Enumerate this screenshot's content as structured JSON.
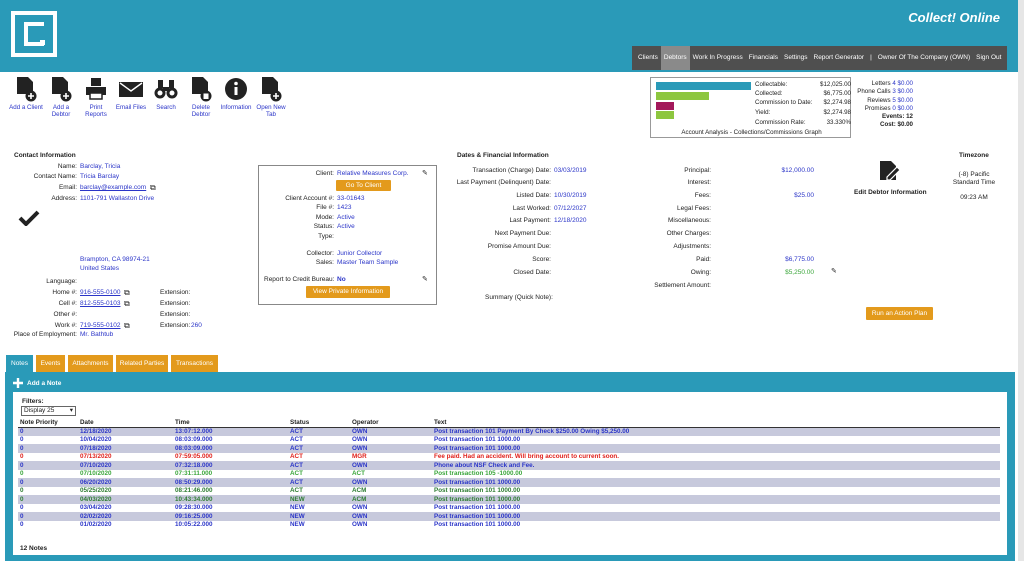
{
  "app": {
    "brand": "Collect! Online"
  },
  "topnav": [
    "Clients",
    "Debtors",
    "Work In Progress",
    "Financials",
    "Settings",
    "Report Generator",
    "|",
    "Owner Of The Company (OWN)",
    "Sign Out"
  ],
  "toolbar": [
    {
      "label": "Add a Client",
      "icon": "add-document-icon"
    },
    {
      "label": "Add a Debtor",
      "icon": "add-document-icon"
    },
    {
      "label": "Print Reports",
      "icon": "printer-icon"
    },
    {
      "label": "Email Files",
      "icon": "envelope-icon"
    },
    {
      "label": "Search",
      "icon": "binoculars-icon"
    },
    {
      "label": "Delete Debtor",
      "icon": "delete-document-icon"
    },
    {
      "label": "Information",
      "icon": "info-icon"
    },
    {
      "label": "Open New Tab",
      "icon": "add-document-icon"
    }
  ],
  "analysis": {
    "rows": [
      {
        "label": "Collectable:",
        "value": "$12,025.00"
      },
      {
        "label": "Collected:",
        "value": "$6,775.00"
      },
      {
        "label": "Commission to Date:",
        "value": "$2,274.98"
      },
      {
        "label": "Yield:",
        "value": "$2,274.98"
      },
      {
        "label": "Commission Rate:",
        "value": "33.330%"
      }
    ],
    "bars": [
      {
        "fraction": 1.0,
        "color": "#2a9ab8"
      },
      {
        "fraction": 0.563,
        "color": "#8dc63f"
      },
      {
        "fraction": 0.19,
        "color": "#a3195b"
      },
      {
        "fraction": 0.19,
        "color": "#8dc63f"
      }
    ],
    "caption": "Account Analysis - Collections/Commissions Graph"
  },
  "stats": {
    "letters": "Letters",
    "letters_n": "4",
    "letters_v": "$0.00",
    "calls": "Phone Calls",
    "calls_n": "3",
    "calls_v": "$0.00",
    "reviews": "Reviews",
    "reviews_n": "5",
    "reviews_v": "$0.00",
    "promises": "Promises",
    "promises_n": "0",
    "promises_v": "$0.00",
    "events": "Events: 12",
    "cost": "Cost: $0.00"
  },
  "contact": {
    "title": "Contact Information",
    "name_l": "Name:",
    "name": "Barclay, Tricia",
    "cname_l": "Contact Name:",
    "cname": "Tricia Barclay",
    "email_l": "Email:",
    "email": "barclay@example.com",
    "address_l": "Address:",
    "address": "1101-791 Wallaston Drive",
    "city": "Brampton, CA 98974-21",
    "country": "United States",
    "language_l": "Language:",
    "home_l": "Home #:",
    "home": "916-555-0100",
    "cell_l": "Cell #:",
    "cell": "812-555-0103",
    "other_l": "Other #:",
    "work_l": "Work #:",
    "work": "719-555-0102",
    "ext_l": "Extension:",
    "work_ext": "260",
    "employ_l": "Place of Employment:",
    "employ": "Mr. Bathtub"
  },
  "client": {
    "client_l": "Client:",
    "client": "Relative Measures Corp.",
    "goto": "Go To Client",
    "acct_l": "Client Account #:",
    "acct": "33-01643",
    "file_l": "File #:",
    "file": "1423",
    "mode_l": "Mode:",
    "mode": "Active",
    "status_l": "Status:",
    "status": "Active",
    "type_l": "Type:",
    "collector_l": "Collector:",
    "collector": "Junior Collector",
    "sales_l": "Sales:",
    "sales": "Master Team Sample",
    "report_l": "Report to Credit Bureau:",
    "report": "No",
    "private": "View Private Information"
  },
  "dates": {
    "title": "Dates & Financial Information",
    "rows": [
      {
        "label": "Transaction (Charge) Date:",
        "value": "03/03/2019"
      },
      {
        "label": "Last Payment (Delinquent) Date:",
        "value": ""
      },
      {
        "label": "Listed Date:",
        "value": "10/30/2019"
      },
      {
        "label": "Last Worked:",
        "value": "07/12/2027"
      },
      {
        "label": "Last Payment:",
        "value": "12/18/2020"
      },
      {
        "label": "Next Payment Due:",
        "value": ""
      },
      {
        "label": "Promise Amount Due:",
        "value": ""
      },
      {
        "label": "Score:",
        "value": ""
      },
      {
        "label": "Closed Date:",
        "value": ""
      }
    ],
    "summary_l": "Summary (Quick Note):"
  },
  "financial": {
    "rows": [
      {
        "label": "Principal:",
        "value": "$12,000.00"
      },
      {
        "label": "Interest:",
        "value": ""
      },
      {
        "label": "Fees:",
        "value": "$25.00"
      },
      {
        "label": "Legal Fees:",
        "value": ""
      },
      {
        "label": "Miscellaneous:",
        "value": ""
      },
      {
        "label": "Other Charges:",
        "value": ""
      },
      {
        "label": "Adjustments:",
        "value": ""
      },
      {
        "label": "Paid:",
        "value": "$6,775.00"
      },
      {
        "label": "Owing:",
        "value": "$5,250.00"
      },
      {
        "label": "Settlement Amount:",
        "value": ""
      }
    ]
  },
  "edit_debtor": "Edit Debtor Information",
  "action_plan": "Run an Action Plan",
  "timezone": {
    "title": "Timezone",
    "zone": "(-8) Pacific Standard Time",
    "time": "09:23 AM"
  },
  "tabs": [
    "Notes",
    "Events",
    "Attachments",
    "Related Parties",
    "Transactions"
  ],
  "notes": {
    "add": "Add a Note",
    "filters_l": "Filters:",
    "filter_value": "Display 25",
    "headers": [
      "Note Priority",
      "Date",
      "Time",
      "Status",
      "Operator",
      "Text"
    ],
    "rows": [
      [
        "0",
        "12/18/2020",
        "13:07:12.000",
        "ACT",
        "OWN",
        "Post transaction 101 Payment By Check $250.00 Owing $5,250.00"
      ],
      [
        "0",
        "10/04/2020",
        "08:03:09.000",
        "ACT",
        "OWN",
        "Post transaction 101 1000.00"
      ],
      [
        "0",
        "07/18/2020",
        "08:03:09.000",
        "ACT",
        "OWN",
        "Post transaction 101 1000.00"
      ],
      [
        "0",
        "07/13/2020",
        "07:59:05.000",
        "ACT",
        "MGR",
        "Fee paid. Had an accident. Will bring account to current soon."
      ],
      [
        "0",
        "07/10/2020",
        "07:32:18.000",
        "ACT",
        "OWN",
        "Phone about NSF Check and Fee."
      ],
      [
        "0",
        "07/10/2020",
        "07:31:11.000",
        "ACT",
        "ACT",
        "Post transaction 105 -1000.00"
      ],
      [
        "0",
        "06/20/2020",
        "08:50:29.000",
        "ACT",
        "OWN",
        "Post transaction 101 1000.00"
      ],
      [
        "0",
        "05/25/2020",
        "08:21:46.000",
        "ACT",
        "ACM",
        "Post transaction 101 1000.00"
      ],
      [
        "0",
        "04/03/2020",
        "10:43:34.000",
        "NEW",
        "ACM",
        "Post transaction 101 1000.00"
      ],
      [
        "0",
        "03/04/2020",
        "09:28:30.000",
        "NEW",
        "OWN",
        "Post transaction 101 1000.00"
      ],
      [
        "0",
        "02/02/2020",
        "09:16:25.000",
        "NEW",
        "OWN",
        "Post transaction 101 1000.00"
      ],
      [
        "0",
        "01/02/2020",
        "10:05:22.000",
        "NEW",
        "OWN",
        "Post transaction 101 1000.00"
      ]
    ],
    "row_colors": [
      "#2b35c8",
      "#2b35c8",
      "#2b35c8",
      "#e0201b",
      "#2b35c8",
      "#3aa63a",
      "#2b35c8",
      "#2e7d32",
      "#2e7d32",
      "#2b35c8",
      "#2b35c8",
      "#2b35c8"
    ],
    "count": "12 Notes"
  }
}
